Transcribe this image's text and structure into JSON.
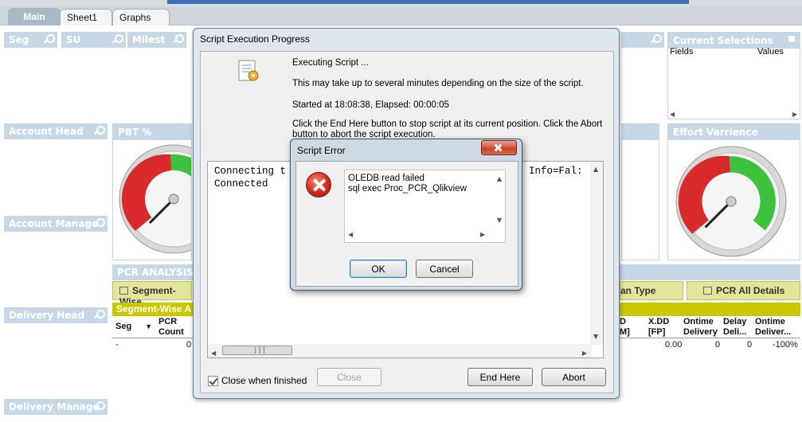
{
  "tabs": [
    "Main",
    "Sheet1",
    "Graphs"
  ],
  "listboxes": {
    "seg": "Seg",
    "su": "SU",
    "milest": "Milest",
    "account_head": "Account Head",
    "account_manage": "Account Manage",
    "delivery_head": "Delivery Head",
    "delivery_manage": "Delivery Manage"
  },
  "current_selections": {
    "title": "Current Selections",
    "col_fields": "Fields",
    "col_values": "Values"
  },
  "pbt": {
    "title": "PBT %"
  },
  "effort": {
    "title": "Effort Varrience"
  },
  "pcr": {
    "title": "PCR ANALYSIS",
    "btn_segment": "Segment-Wise",
    "btn_plan_type": "an Type",
    "btn_all_details": "PCR All Details",
    "table_title": "Segment-Wise A",
    "left_cols": [
      "Seg",
      "PCR\nCount"
    ],
    "left_row": [
      "-",
      "0"
    ],
    "right_cols": [
      "D\nM]",
      "X.DD\n[FP]",
      "Ontime\nDelivery",
      "Delay\nDeli...",
      "Ontime\nDeliver..."
    ],
    "right_row": [
      "",
      "0.00",
      "0",
      "0",
      "-100%"
    ]
  },
  "progress_dialog": {
    "title": "Script Execution Progress",
    "line1": "Executing Script ...",
    "line2": "This may take up to several minutes depending on the size of the script.",
    "line3": "Started at 18:08:38, Elapsed: 00:00:05",
    "line4": "Click the End Here button to stop script at its current position. Click the Abort",
    "line5": "button to abort the script execution.",
    "log_line1": "Connecting t",
    "log_line1_end": "y Info=Fal:",
    "log_line2": "Connected",
    "checkbox_label": "Close when finished",
    "close_btn": "Close",
    "endhere_btn": "End Here",
    "abort_btn": "Abort"
  },
  "error_dialog": {
    "title": "Script Error",
    "msg1": "OLEDB read failed",
    "msg2": "sql exec Proc_PCR_Qlikview",
    "ok_btn": "OK",
    "cancel_btn": "Cancel"
  }
}
